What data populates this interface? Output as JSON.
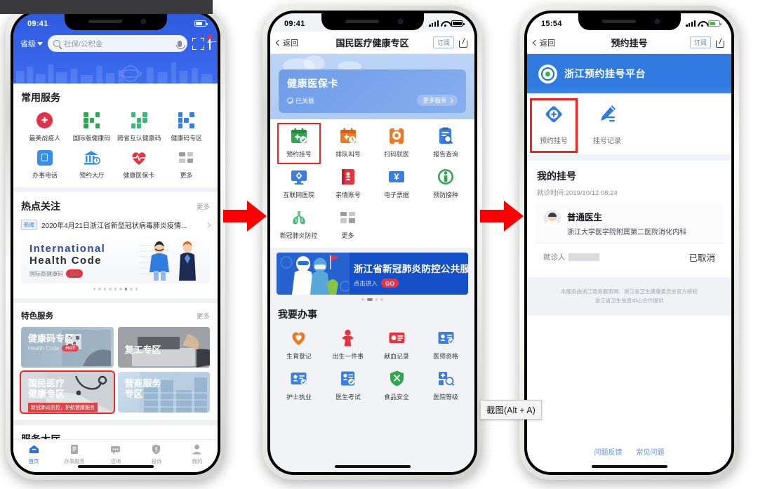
{
  "overlay": {
    "tooltip": "截图(Alt + A)"
  },
  "phone1": {
    "status": {
      "time": "09:41"
    },
    "header": {
      "region": "省级",
      "search_placeholder": "社保/公积金",
      "search_value": "",
      "scan_icon": "scan-icon",
      "mail_icon": "mail-icon"
    },
    "common_services": {
      "title": "常用服务",
      "items": [
        {
          "label": "最美战疫人",
          "icon": "medal-icon",
          "color": "#e0334a"
        },
        {
          "label": "国际版健康码",
          "icon": "qr-icon",
          "color": "#2fa84f"
        },
        {
          "label": "跨省互认健康码",
          "icon": "qr-health-icon",
          "color": "#3cb878"
        },
        {
          "label": "健康码专区",
          "icon": "qr-blue-icon",
          "color": "#3a7ee0"
        },
        {
          "label": "办事电话",
          "icon": "phone-icon",
          "color": "#3a8ee8"
        },
        {
          "label": "预约大厅",
          "icon": "bank-clock-icon",
          "color": "#3a8ee8"
        },
        {
          "label": "健康医保卡",
          "icon": "heartbeat-icon",
          "color": "#e8333f"
        },
        {
          "label": "更多",
          "icon": "grid-more-icon",
          "color": "#8c8c94"
        }
      ]
    },
    "hotspot": {
      "title": "热点关注",
      "more": "更多",
      "news_tag": "新闻",
      "news_text": "2020年4月21日浙江省新型冠状病毒肺炎疫情..."
    },
    "banner": {
      "line1": "International",
      "line2": "Health Code",
      "sub": "国际版健康码",
      "go": "GO",
      "dot_count": 9,
      "dot_active": 6
    },
    "featured": {
      "title": "特色服务",
      "more": "更多",
      "cards": [
        {
          "title": "健康码专区",
          "subtitle": "Health Code",
          "badge": "HOT",
          "selected": false
        },
        {
          "title": "复工专区",
          "subtitle": "",
          "badge": "",
          "selected": false
        },
        {
          "title": "国民医疗\n健康专区",
          "subtitle": "新冠肺炎防控，护航健康服务",
          "badge": "",
          "selected": true
        },
        {
          "title": "营商服务\n专区",
          "subtitle": "",
          "badge": "",
          "selected": false
        }
      ]
    },
    "next_section_title": "服务大厅",
    "tabbar": [
      {
        "label": "首页",
        "icon": "home-icon",
        "active": true
      },
      {
        "label": "办事服务",
        "icon": "services-icon",
        "active": false
      },
      {
        "label": "咨询",
        "icon": "chat-icon",
        "active": false
      },
      {
        "label": "投诉",
        "icon": "shield-icon",
        "active": false
      },
      {
        "label": "我的",
        "icon": "user-icon",
        "active": false
      }
    ]
  },
  "phone2": {
    "status": {
      "time": "09:41"
    },
    "nav": {
      "back": "返回",
      "title": "国民医疗健康专区",
      "subscribe": "订阅",
      "share_icon": "share-icon"
    },
    "health_card": {
      "title": "健康医保卡",
      "status": "已关联",
      "more": "更多服务"
    },
    "services": [
      {
        "label": "预约挂号",
        "icon": "calendar-check-icon",
        "color": "#2fa84f",
        "selected": true
      },
      {
        "label": "排队叫号",
        "icon": "calendar-queue-icon",
        "color": "#f07820",
        "selected": false
      },
      {
        "label": "扫码就医",
        "icon": "scan-code-icon",
        "color": "#f07820",
        "selected": false
      },
      {
        "label": "报告查询",
        "icon": "report-search-icon",
        "color": "#3a7ee0",
        "selected": false
      },
      {
        "label": "互联网医院",
        "icon": "online-hospital-icon",
        "color": "#3a7ee0",
        "selected": false
      },
      {
        "label": "亲情账号",
        "icon": "family-account-icon",
        "color": "#e8333f",
        "selected": false
      },
      {
        "label": "电子票据",
        "icon": "e-invoice-icon",
        "color": "#3a7ee0",
        "selected": false
      },
      {
        "label": "预防接种",
        "icon": "vaccine-icon",
        "color": "#2fa84f",
        "selected": false
      },
      {
        "label": "新冠肺炎防控",
        "icon": "lungs-icon",
        "color": "#3cb878",
        "selected": false
      },
      {
        "label": "更多",
        "icon": "grid-more-icon",
        "color": "#8c8c94",
        "selected": false
      }
    ],
    "banner": {
      "title": "浙江省新冠肺炎防控公共服",
      "sub": "点击进入",
      "go": "GO",
      "dot_count": 4,
      "dot_active": 1
    },
    "work": {
      "title": "我要办事",
      "items": [
        {
          "label": "生育登记",
          "icon": "birth-heart-icon",
          "color": "#f07820"
        },
        {
          "label": "出生一件事",
          "icon": "baby-icon",
          "color": "#e8333f"
        },
        {
          "label": "献血记录",
          "icon": "blood-record-icon",
          "color": "#e8333f"
        },
        {
          "label": "医师资格",
          "icon": "doctor-cert-icon",
          "color": "#3a7ee0"
        },
        {
          "label": "护士执业",
          "icon": "nurse-cert-icon",
          "color": "#3a7ee0"
        },
        {
          "label": "医生考试",
          "icon": "doctor-exam-icon",
          "color": "#3a7ee0"
        },
        {
          "label": "食品安全",
          "icon": "food-safety-icon",
          "color": "#2fa84f"
        },
        {
          "label": "医院等级",
          "icon": "hospital-grade-icon",
          "color": "#3a7ee0"
        }
      ]
    }
  },
  "phone3": {
    "status": {
      "time": "15:54"
    },
    "nav": {
      "back": "返回",
      "title": "预约挂号",
      "subscribe": "订阅",
      "share_icon": "share-icon"
    },
    "platform": {
      "name": "浙江预约挂号平台",
      "logo_icon": "platform-logo-icon"
    },
    "entries": [
      {
        "label": "预约挂号",
        "icon": "plus-diamond-icon",
        "selected": true
      },
      {
        "label": "挂号记录",
        "icon": "pencil-record-icon",
        "selected": false
      }
    ],
    "my_reg": {
      "title": "我的挂号",
      "visit_time": "就诊时间:2019/10/12 08:24",
      "doctor_name": "普通医生",
      "hospital": "浙江大学医学院附属第二医院消化内科",
      "patient_label": "就诊人",
      "patient_value": "",
      "status": "已取消"
    },
    "footer": {
      "line1": "本服务由浙江政务服务网、浙江省卫生健康委员会官方授权",
      "line2": "浙江省卫生信息中心合作提供"
    },
    "links": [
      "问题反馈",
      "常见问题"
    ]
  }
}
